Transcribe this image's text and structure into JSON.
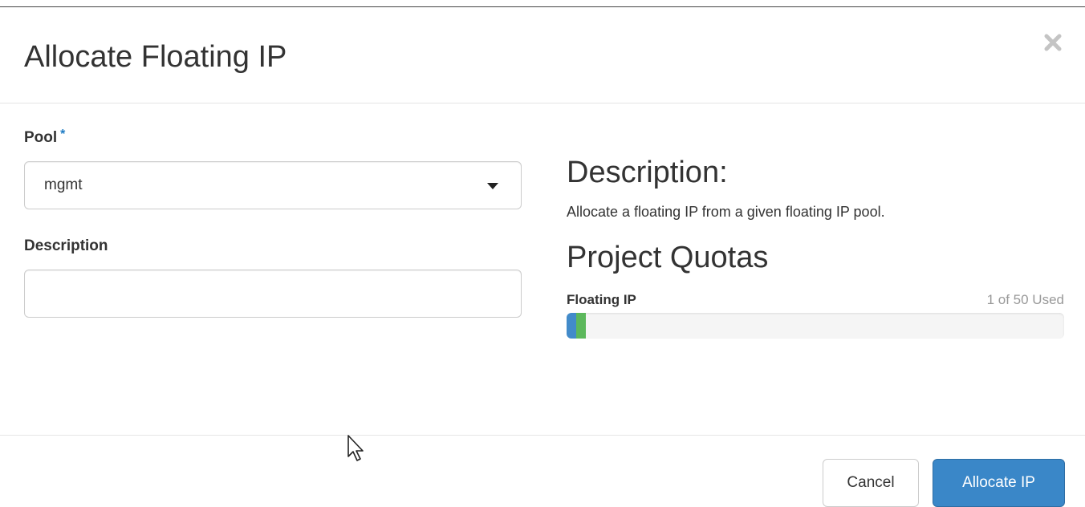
{
  "dialog": {
    "title": "Allocate Floating IP",
    "close_icon": "close-icon"
  },
  "form": {
    "pool_label": "Pool",
    "required_marker": "*",
    "pool_selected": "mgmt",
    "description_label": "Description",
    "description_value": "",
    "description_placeholder": ""
  },
  "help": {
    "heading": "Description:",
    "text": "Allocate a floating IP from a given floating IP pool."
  },
  "quotas": {
    "heading": "Project Quotas",
    "items": [
      {
        "label": "Floating IP",
        "used_text": "1 of 50 Used",
        "used": 1,
        "limit": 50,
        "allocating": 1
      }
    ]
  },
  "footer": {
    "cancel_label": "Cancel",
    "submit_label": "Allocate IP"
  },
  "colors": {
    "primary": "#3a87c8",
    "required": "#1c7bc4",
    "quota_current": "#428bca",
    "quota_new": "#5cb85c"
  }
}
